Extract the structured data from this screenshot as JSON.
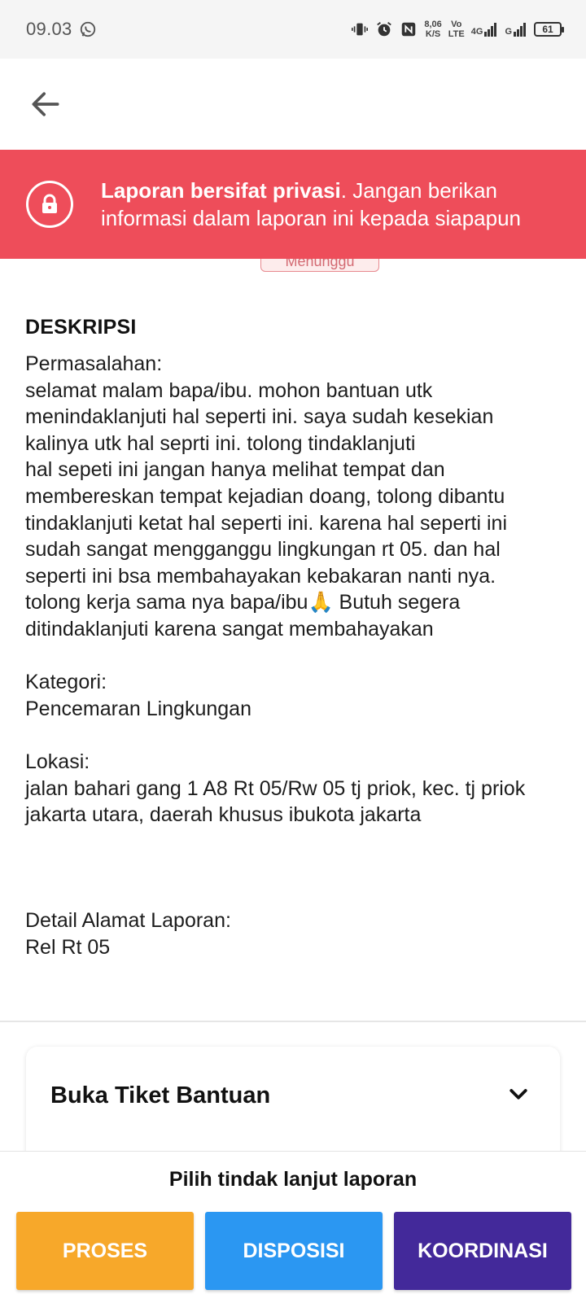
{
  "statusbar": {
    "time": "09.03",
    "net_speed_value": "8,06",
    "net_speed_unit": "K/S",
    "volte_top": "Vo",
    "volte_bottom": "LTE",
    "net_type_1": "4G",
    "net_type_2": "G",
    "battery": "61"
  },
  "banner": {
    "bold_text": "Laporan bersifat privasi",
    "text": ". Jangan berikan informasi dalam laporan ini kepada siapapun"
  },
  "status_badge": "Menunggu",
  "description": {
    "title": "DESKRIPSI",
    "problem_label": "Permasalahan:",
    "problem_text_1": "selamat malam bapa/ibu. mohon bantuan utk menindaklanjuti hal seperti ini. saya sudah kesekian kalinya utk hal seprti ini. tolong tindaklanjuti",
    "problem_text_2": "hal sepeti ini jangan hanya melihat tempat dan membereskan tempat kejadian doang, tolong dibantu tindaklanjuti ketat hal seperti ini. karena hal seperti ini sudah sangat mengganggu lingkungan rt 05. dan hal seperti ini bsa membahayakan kebakaran nanti nya.",
    "problem_text_3": "tolong kerja sama nya bapa/ibu🙏 Butuh segera ditindaklanjuti karena sangat membahayakan",
    "category_label": "Kategori:",
    "category_value": "Pencemaran Lingkungan",
    "location_label": "Lokasi:",
    "location_value": "jalan bahari gang 1 A8 Rt 05/Rw 05 tj priok, kec. tj priok jakarta utara, daerah khusus ibukota jakarta",
    "address_detail_label": "Detail Alamat Laporan:",
    "address_detail_value": "Rel Rt 05"
  },
  "ticket": {
    "title": "Buka Tiket Bantuan"
  },
  "bottom": {
    "title": "Pilih tindak lanjut laporan",
    "actions": [
      {
        "label": "PROSES",
        "color": "#f7a82a"
      },
      {
        "label": "DISPOSISI",
        "color": "#2b97f2"
      },
      {
        "label": "KOORDINASI",
        "color": "#43299a"
      }
    ]
  },
  "colors": {
    "banner": "#ee4d5a"
  }
}
